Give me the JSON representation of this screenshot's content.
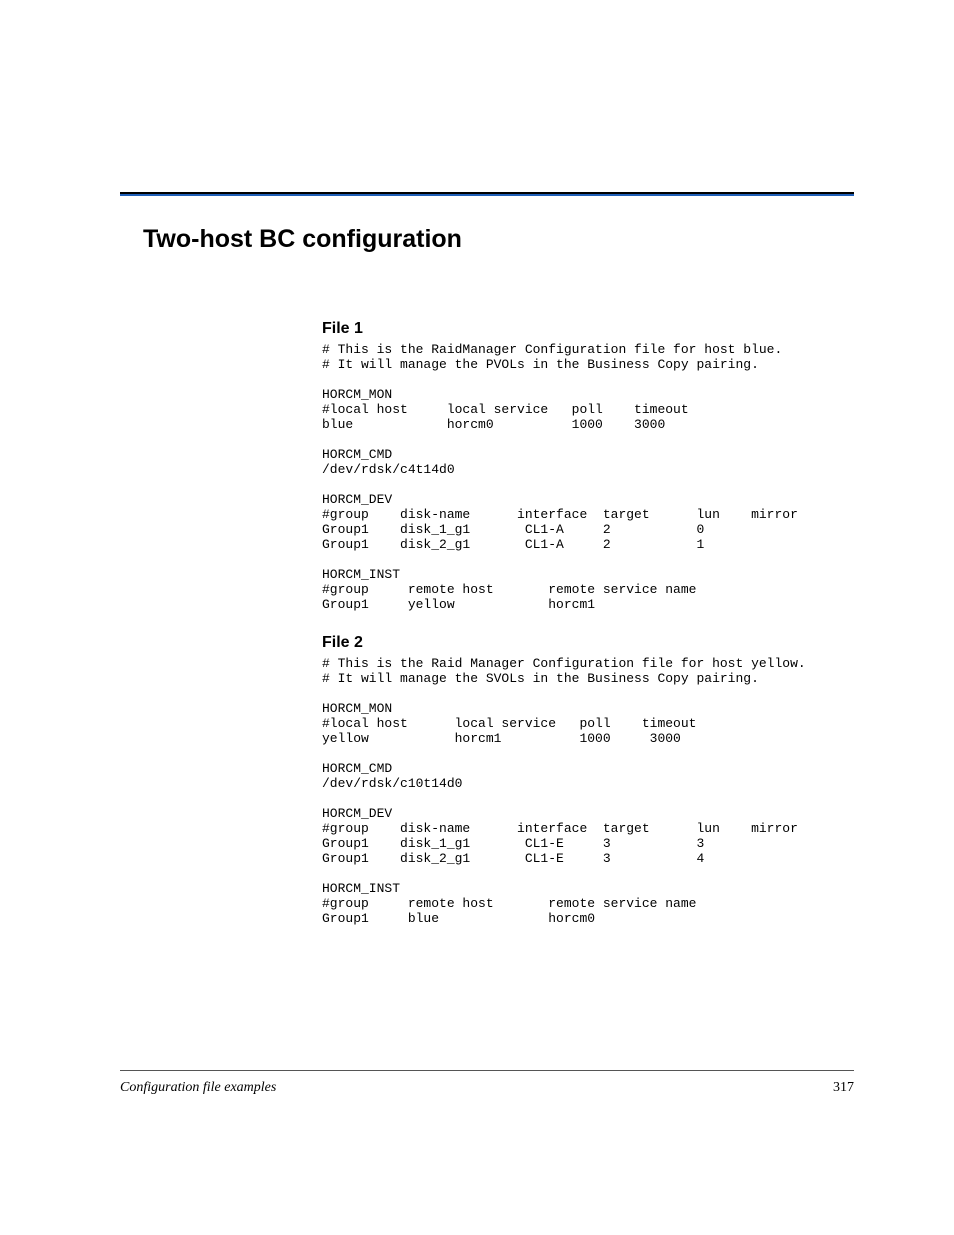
{
  "section_title": "Two-host BC configuration",
  "file1": {
    "heading": "File 1",
    "text": "# This is the RaidManager Configuration file for host blue.\n# It will manage the PVOLs in the Business Copy pairing.\n\nHORCM_MON\n#local host     local service   poll    timeout\nblue            horcm0          1000    3000\n\nHORCM_CMD\n/dev/rdsk/c4t14d0\n\nHORCM_DEV\n#group    disk-name      interface  target      lun    mirror\nGroup1    disk_1_g1       CL1-A     2           0\nGroup1    disk_2_g1       CL1-A     2           1\n\nHORCM_INST\n#group     remote host       remote service name\nGroup1     yellow            horcm1"
  },
  "file2": {
    "heading": "File 2",
    "text": "# This is the Raid Manager Configuration file for host yellow.\n# It will manage the SVOLs in the Business Copy pairing.\n\nHORCM_MON\n#local host      local service   poll    timeout\nyellow           horcm1          1000     3000\n\nHORCM_CMD\n/dev/rdsk/c10t14d0\n\nHORCM_DEV\n#group    disk-name      interface  target      lun    mirror\nGroup1    disk_1_g1       CL1-E     3           3\nGroup1    disk_2_g1       CL1-E     3           4\n\nHORCM_INST\n#group     remote host       remote service name\nGroup1     blue              horcm0"
  },
  "footer": {
    "left": "Configuration file examples",
    "page": "317"
  }
}
